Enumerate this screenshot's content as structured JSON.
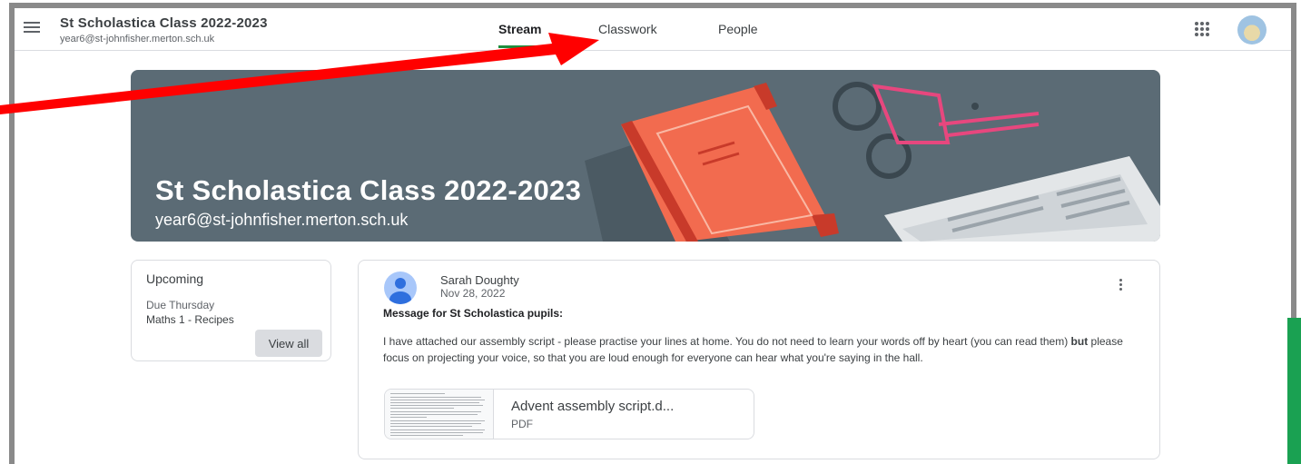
{
  "header": {
    "class_title": "St Scholastica Class 2022-2023",
    "class_email": "year6@st-johnfisher.merton.sch.uk",
    "tabs": [
      {
        "label": "Stream",
        "active": true
      },
      {
        "label": "Classwork",
        "active": false
      },
      {
        "label": "People",
        "active": false
      }
    ],
    "menu_icon": "hamburger-menu-icon",
    "apps_icon": "google-apps-grid-icon"
  },
  "banner": {
    "title": "St Scholastica Class 2022-2023",
    "subtitle": "year6@st-johnfisher.merton.sch.uk",
    "background_color": "#5b6b75"
  },
  "upcoming": {
    "title": "Upcoming",
    "due": "Due Thursday",
    "item": "Maths 1 - Recipes",
    "view_all_label": "View all"
  },
  "post": {
    "author": "Sarah Doughty",
    "date": "Nov 28, 2022",
    "heading": "Message for St Scholastica pupils:",
    "text_before_bold": "I have attached our assembly script - please practise your lines at home. You do not need to learn your words off by heart (you can read them) ",
    "text_bold": "but",
    "text_after_bold": " please focus on projecting your voice, so that you are loud enough for everyone can hear what you're saying in the hall.",
    "attachment": {
      "name": "Advent assembly script.d...",
      "type": "PDF"
    }
  },
  "colors": {
    "annotation_arrow": "#ff0000",
    "active_tab_underline": "#1e8e3e",
    "side_strip": "#1aa152"
  }
}
